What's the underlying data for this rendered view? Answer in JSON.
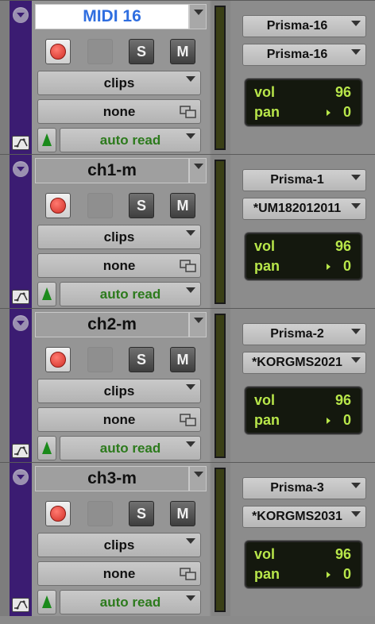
{
  "tracks": [
    {
      "name": "MIDI 16",
      "selected": true,
      "solo_label": "S",
      "mute_label": "M",
      "playlist": "clips",
      "group": "none",
      "automation": "auto read",
      "output": "Prisma-16",
      "input": "Prisma-16",
      "vol_label": "vol",
      "vol_value": "96",
      "pan_label": "pan",
      "pan_value": "0"
    },
    {
      "name": "ch1-m",
      "selected": false,
      "solo_label": "S",
      "mute_label": "M",
      "playlist": "clips",
      "group": "none",
      "automation": "auto read",
      "output": "Prisma-1",
      "input": "*UM182012011",
      "vol_label": "vol",
      "vol_value": "96",
      "pan_label": "pan",
      "pan_value": "0"
    },
    {
      "name": "ch2-m",
      "selected": false,
      "solo_label": "S",
      "mute_label": "M",
      "playlist": "clips",
      "group": "none",
      "automation": "auto read",
      "output": "Prisma-2",
      "input": "*KORGMS2021",
      "vol_label": "vol",
      "vol_value": "96",
      "pan_label": "pan",
      "pan_value": "0"
    },
    {
      "name": "ch3-m",
      "selected": false,
      "solo_label": "S",
      "mute_label": "M",
      "playlist": "clips",
      "group": "none",
      "automation": "auto read",
      "output": "Prisma-3",
      "input": "*KORGMS2031",
      "vol_label": "vol",
      "vol_value": "96",
      "pan_label": "pan",
      "pan_value": "0"
    }
  ],
  "colors": {
    "track_color": "#3b1c72",
    "selected_name": "#2f6ee0",
    "automation_text": "#2c7a1c",
    "lcd_text": "#b8e64a",
    "lcd_bg": "#14180e",
    "record": "#d23028"
  },
  "icons": {
    "collapse": "chevron-down-icon",
    "record": "record-icon",
    "group": "window-icon",
    "automation": "automation-icon",
    "track_type": "waveform-icon"
  }
}
